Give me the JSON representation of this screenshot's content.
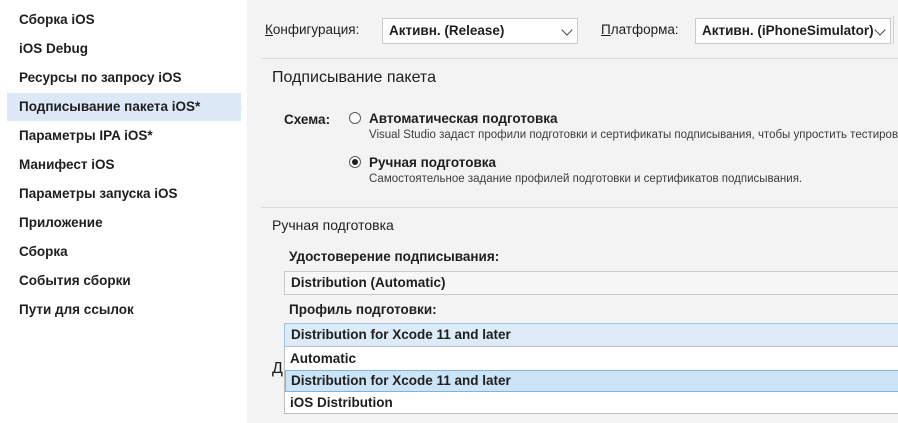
{
  "sidebar": {
    "items": [
      {
        "label": "Сборка iOS",
        "selected": false
      },
      {
        "label": "iOS Debug",
        "selected": false
      },
      {
        "label": "Ресурсы по запросу iOS",
        "selected": false
      },
      {
        "label": "Подписывание пакета iOS*",
        "selected": true
      },
      {
        "label": "Параметры IPA iOS*",
        "selected": false
      },
      {
        "label": "Манифест iOS",
        "selected": false
      },
      {
        "label": "Параметры запуска iOS",
        "selected": false
      },
      {
        "label": "Приложение",
        "selected": false
      },
      {
        "label": "Сборка",
        "selected": false
      },
      {
        "label": "События сборки",
        "selected": false
      },
      {
        "label": "Пути для ссылок",
        "selected": false
      }
    ]
  },
  "toolbar": {
    "config_label_accel": "К",
    "config_label_rest": "онфигурация:",
    "config_value": "Активн. (Release)",
    "platform_label_accel": "П",
    "platform_label_rest": "латформа:",
    "platform_value": "Активн. (iPhoneSimulator)"
  },
  "signing": {
    "section_title": "Подписывание пакета",
    "scheme_label": "Схема:",
    "options": [
      {
        "title": "Автоматическая подготовка",
        "description": "Visual Studio задаст профили подготовки и сертификаты подписывания, чтобы упростить тестирование",
        "checked": false
      },
      {
        "title": "Ручная подготовка",
        "description": "Самостоятельное задание профилей подготовки и сертификатов подписывания.",
        "checked": true
      }
    ]
  },
  "manual": {
    "section_title": "Ручная подготовка",
    "identity_label": "Удостоверение подписывания:",
    "identity_value": "Distribution (Automatic)",
    "profile_label": "Профиль подготовки:",
    "profile_value": "Distribution for Xcode 11 and later",
    "profile_options": [
      {
        "label": "Automatic",
        "highlighted": false
      },
      {
        "label": "Distribution for Xcode 11 and later",
        "highlighted": true
      },
      {
        "label": "iOS Distribution",
        "highlighted": false
      }
    ],
    "obscured_heading_fragment": "Д"
  },
  "colors": {
    "selected_nav_bg": "#dde8f7",
    "main_bg": "#f3f3f3",
    "highlight_bg": "#cce4f7"
  },
  "icons": {
    "combo_chevron": "chevron-down-icon"
  }
}
